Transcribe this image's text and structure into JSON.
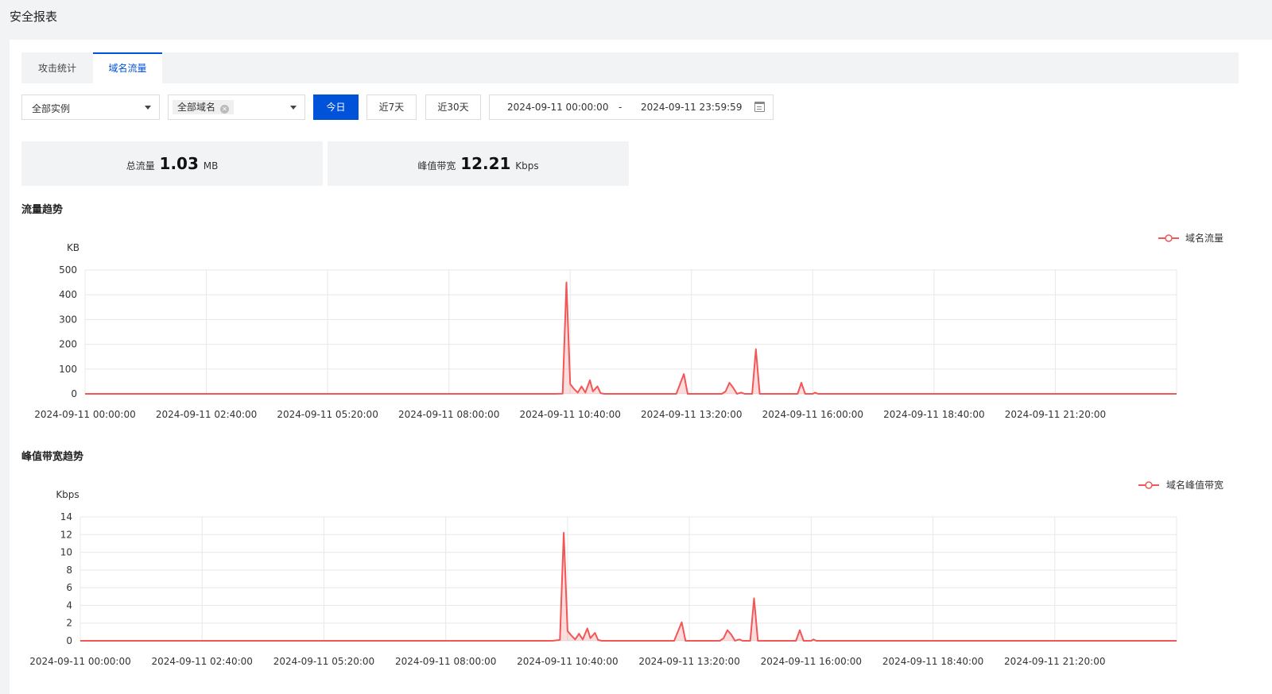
{
  "header": {
    "title": "安全报表"
  },
  "tabs": [
    {
      "label": "攻击统计",
      "active": false
    },
    {
      "label": "域名流量",
      "active": true
    }
  ],
  "toolbar": {
    "instance_select": "全部实例",
    "domain_tag": "全部域名",
    "btn_today": "今日",
    "btn_7d": "近7天",
    "btn_30d": "近30天",
    "date_start": "2024-09-11 00:00:00",
    "date_sep": "-",
    "date_end": "2024-09-11 23:59:59"
  },
  "stats": {
    "total_label": "总流量",
    "total_value": "1.03",
    "total_unit": "MB",
    "peak_label": "峰值带宽",
    "peak_value": "12.21",
    "peak_unit": "Kbps"
  },
  "colors": {
    "accent": "#0052d9",
    "series": "#f25656"
  },
  "sections": {
    "traffic_title": "流量趋势",
    "bandwidth_title": "峰值带宽趋势"
  },
  "chart_data": [
    {
      "type": "area",
      "title": "",
      "ylabel": "KB",
      "xlabel": "",
      "ylim": [
        0,
        500
      ],
      "yticks": [
        0,
        100,
        200,
        300,
        400,
        500
      ],
      "x_tick_labels": [
        "2024-09-11 00:00:00",
        "2024-09-11 02:40:00",
        "2024-09-11 05:20:00",
        "2024-09-11 08:00:00",
        "2024-09-11 10:40:00",
        "2024-09-11 13:20:00",
        "2024-09-11 16:00:00",
        "2024-09-11 18:40:00",
        "2024-09-11 21:20:00"
      ],
      "x_range_minutes": [
        0,
        1440
      ],
      "grid": true,
      "legend_position": "top-right",
      "series": [
        {
          "name": "域名流量",
          "points": [
            [
              0,
              0
            ],
            [
              620,
              0
            ],
            [
              630,
              1
            ],
            [
              635,
              450
            ],
            [
              640,
              40
            ],
            [
              645,
              20
            ],
            [
              650,
              5
            ],
            [
              655,
              30
            ],
            [
              660,
              5
            ],
            [
              666,
              55
            ],
            [
              670,
              10
            ],
            [
              676,
              30
            ],
            [
              680,
              3
            ],
            [
              685,
              0
            ],
            [
              780,
              0
            ],
            [
              790,
              80
            ],
            [
              795,
              0
            ],
            [
              840,
              0
            ],
            [
              845,
              10
            ],
            [
              850,
              45
            ],
            [
              855,
              25
            ],
            [
              860,
              0
            ],
            [
              863,
              3
            ],
            [
              866,
              5
            ],
            [
              870,
              0
            ],
            [
              880,
              0
            ],
            [
              885,
              180
            ],
            [
              890,
              0
            ],
            [
              940,
              0
            ],
            [
              945,
              45
            ],
            [
              950,
              0
            ],
            [
              960,
              0
            ],
            [
              963,
              5
            ],
            [
              967,
              0
            ],
            [
              1440,
              0
            ]
          ]
        }
      ]
    },
    {
      "type": "area",
      "title": "",
      "ylabel": "Kbps",
      "xlabel": "",
      "ylim": [
        0,
        14
      ],
      "yticks": [
        0,
        2,
        4,
        6,
        8,
        10,
        12,
        14
      ],
      "x_tick_labels": [
        "2024-09-11 00:00:00",
        "2024-09-11 02:40:00",
        "2024-09-11 05:20:00",
        "2024-09-11 08:00:00",
        "2024-09-11 10:40:00",
        "2024-09-11 13:20:00",
        "2024-09-11 16:00:00",
        "2024-09-11 18:40:00",
        "2024-09-11 21:20:00"
      ],
      "x_range_minutes": [
        0,
        1440
      ],
      "grid": true,
      "legend_position": "top-right",
      "series": [
        {
          "name": "域名峰值带宽",
          "points": [
            [
              0,
              0
            ],
            [
              620,
              0
            ],
            [
              630,
              0.1
            ],
            [
              635,
              12.21
            ],
            [
              640,
              1.1
            ],
            [
              645,
              0.6
            ],
            [
              650,
              0.15
            ],
            [
              655,
              0.8
            ],
            [
              660,
              0.15
            ],
            [
              666,
              1.4
            ],
            [
              670,
              0.3
            ],
            [
              676,
              0.9
            ],
            [
              680,
              0.1
            ],
            [
              685,
              0
            ],
            [
              780,
              0
            ],
            [
              790,
              2.1
            ],
            [
              795,
              0
            ],
            [
              840,
              0
            ],
            [
              845,
              0.3
            ],
            [
              850,
              1.2
            ],
            [
              855,
              0.7
            ],
            [
              860,
              0
            ],
            [
              863,
              0.1
            ],
            [
              866,
              0.15
            ],
            [
              870,
              0
            ],
            [
              880,
              0
            ],
            [
              885,
              4.8
            ],
            [
              890,
              0
            ],
            [
              940,
              0
            ],
            [
              945,
              1.2
            ],
            [
              950,
              0
            ],
            [
              960,
              0
            ],
            [
              963,
              0.15
            ],
            [
              967,
              0
            ],
            [
              1440,
              0
            ]
          ]
        }
      ]
    }
  ]
}
